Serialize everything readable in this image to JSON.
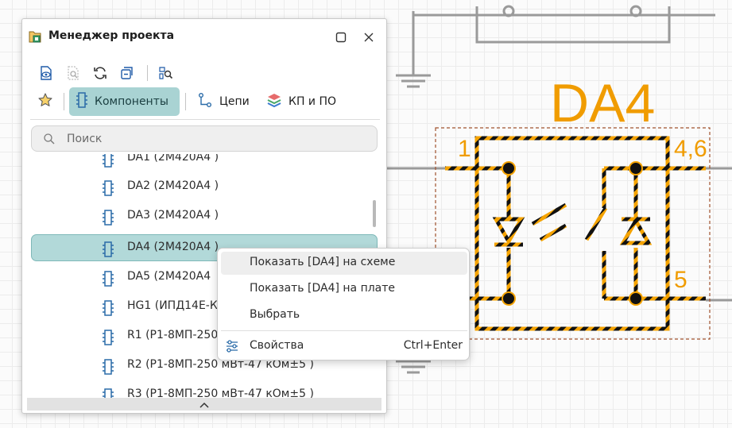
{
  "schematic": {
    "designator": "DA4",
    "pins": {
      "left": "1",
      "right_top": "4,6",
      "right_bottom": "5"
    },
    "colors": {
      "component": "#f09c00",
      "wire": "#9a9a9a",
      "highlight": "#f5a300"
    }
  },
  "panel": {
    "title": "Менеджер проекта",
    "title_icon": "project-manager-icon",
    "toolbar_icons": [
      "view-icon",
      "find-disabled-icon",
      "refresh-icon",
      "collapse-icon",
      "zoom-find-icon"
    ],
    "filters": [
      {
        "label": "",
        "icon": "star-icon"
      },
      {
        "label": "Компоненты",
        "icon": "component-icon",
        "active": true
      },
      {
        "label": "Цепи",
        "icon": "net-icon"
      },
      {
        "label": "КП и ПО",
        "icon": "layers-icon"
      }
    ],
    "search": {
      "placeholder": "Поиск",
      "value": ""
    },
    "items": [
      {
        "label": "DA1 (2М420А4 )"
      },
      {
        "label": "DA2 (2М420А4 )"
      },
      {
        "label": "DA3 (2М420А4 )"
      },
      {
        "label": "DA4 (2М420А4 )",
        "selected": true
      },
      {
        "label": "DA5 (2М420А4"
      },
      {
        "label": "HG1 (ИПД14Е-К"
      },
      {
        "label": "R1 (Р1-8МП-250"
      },
      {
        "label": "R2 (Р1-8МП-250 мВт-47 кОм±5 )"
      },
      {
        "label": "R3 (Р1-8МП-250 мВт-47 кОм±5 )"
      }
    ]
  },
  "context_menu": {
    "items": [
      {
        "label": "Показать [DA4] на схеме",
        "highlighted": true
      },
      {
        "label": "Показать [DA4] на плате"
      },
      {
        "label": "Выбрать"
      },
      {
        "label": "Свойства",
        "shortcut": "Ctrl+Enter",
        "icon": "settings-sliders-icon"
      }
    ]
  }
}
